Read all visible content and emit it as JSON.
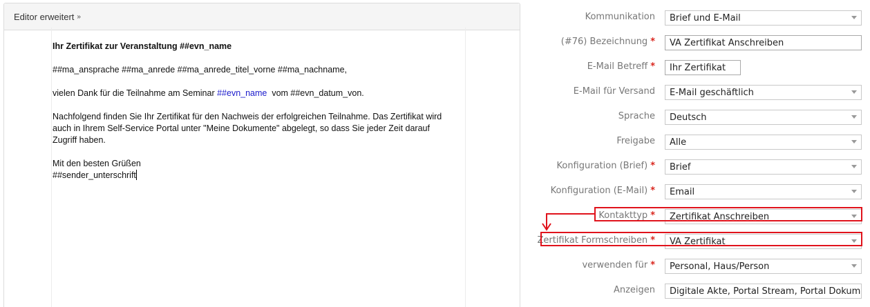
{
  "editor": {
    "toggle_label": "Editor erweitert",
    "title": "Ihr Zertifikat zur Veranstaltung ##evn_name",
    "salutation": "##ma_ansprache ##ma_anrede ##ma_anrede_titel_vorne ##ma_nachname,",
    "thanks_prefix": "vielen Dank für die Teilnahme am Seminar ",
    "thanks_var": "##evn_name",
    "thanks_suffix": "  vom ##evn_datum_von.",
    "body_line1": "Nachfolgend finden Sie Ihr Zertifikat für den Nachweis der erfolgreichen Teilnahme. Das Zertifikat wird",
    "body_line2": "auch in Ihrem Self-Service Portal unter \"Meine Dokumente\" abgelegt, so dass Sie jeder Zeit darauf",
    "body_line3": "Zugriff haben.",
    "closing": "Mit den besten Grüßen",
    "signature": "##sender_unterschrift"
  },
  "form": {
    "kommunikation": {
      "label": "Kommunikation",
      "value": "Brief und E-Mail"
    },
    "bezeichnung": {
      "label": "(#76) Bezeichnung",
      "value": "VA Zertifikat Anschreiben"
    },
    "betreff": {
      "label": "E-Mail Betreff",
      "value": "Ihr Zertifikat"
    },
    "versand": {
      "label": "E-Mail für Versand",
      "value": "E-Mail geschäftlich"
    },
    "sprache": {
      "label": "Sprache",
      "value": "Deutsch"
    },
    "freigabe": {
      "label": "Freigabe",
      "value": "Alle"
    },
    "konfig_brief": {
      "label": "Konfiguration (Brief)",
      "value": "Brief"
    },
    "konfig_email": {
      "label": "Konfiguration (E-Mail)",
      "value": "Email"
    },
    "kontakttyp": {
      "label": "Kontakttyp",
      "value": "Zertifikat Anschreiben"
    },
    "formschreiben": {
      "label": "Zertifikat Formschreiben",
      "value": "VA Zertifikat"
    },
    "verwenden": {
      "label": "verwenden für",
      "value": "Personal, Haus/Person"
    },
    "anzeigen": {
      "label": "Anzeigen",
      "value": "Digitale Akte, Portal Stream, Portal Dokum"
    }
  },
  "required_mark": "*",
  "colors": {
    "required": "#d9251d",
    "highlight": "#e0121b",
    "variable": "#1a1acc"
  }
}
